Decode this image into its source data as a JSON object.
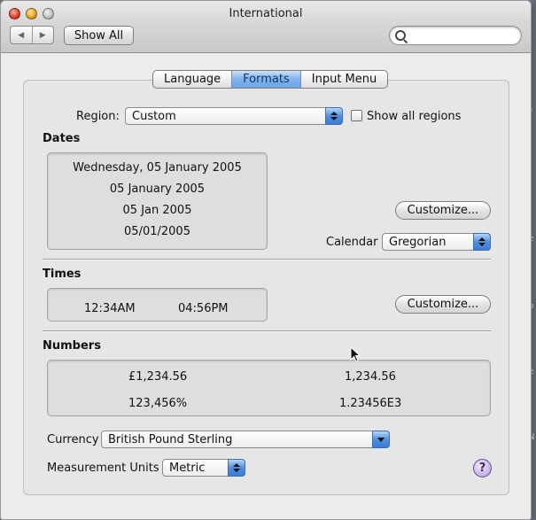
{
  "window": {
    "title": "International",
    "show_all_label": "Show All",
    "search_placeholder": "",
    "nav_back_glyph": "◀",
    "nav_forward_glyph": "▶"
  },
  "tabs": [
    {
      "label": "Language",
      "active": false
    },
    {
      "label": "Formats",
      "active": true
    },
    {
      "label": "Input Menu",
      "active": false
    }
  ],
  "region": {
    "label": "Region:",
    "value": "Custom",
    "show_all_label": "Show all regions",
    "show_all_checked": false
  },
  "dates": {
    "heading": "Dates",
    "samples": [
      "Wednesday, 05 January 2005",
      "05 January 2005",
      "05 Jan 2005",
      "05/01/2005"
    ],
    "customize_label": "Customize...",
    "calendar_label": "Calendar",
    "calendar_value": "Gregorian"
  },
  "times": {
    "heading": "Times",
    "samples": [
      "12:34AM",
      "04:56PM"
    ],
    "customize_label": "Customize..."
  },
  "numbers": {
    "heading": "Numbers",
    "samples": [
      "£1,234.56",
      "1,234.56",
      "123,456%",
      "1.23456E3"
    ]
  },
  "currency": {
    "label": "Currency",
    "value": "British Pound Sterling"
  },
  "measurement": {
    "label": "Measurement Units",
    "value": "Metric"
  },
  "help_label": "?",
  "colors": {
    "accent": "#6aa5e6",
    "close": "#e0442e",
    "minimize": "#e7a821",
    "help": "#c9b8e6"
  },
  "icons": {
    "close": "close-icon",
    "minimize": "minimize-icon",
    "zoom": "zoom-icon",
    "search": "search-icon",
    "help": "help-icon",
    "cursor": "cursor-arrow-icon"
  }
}
